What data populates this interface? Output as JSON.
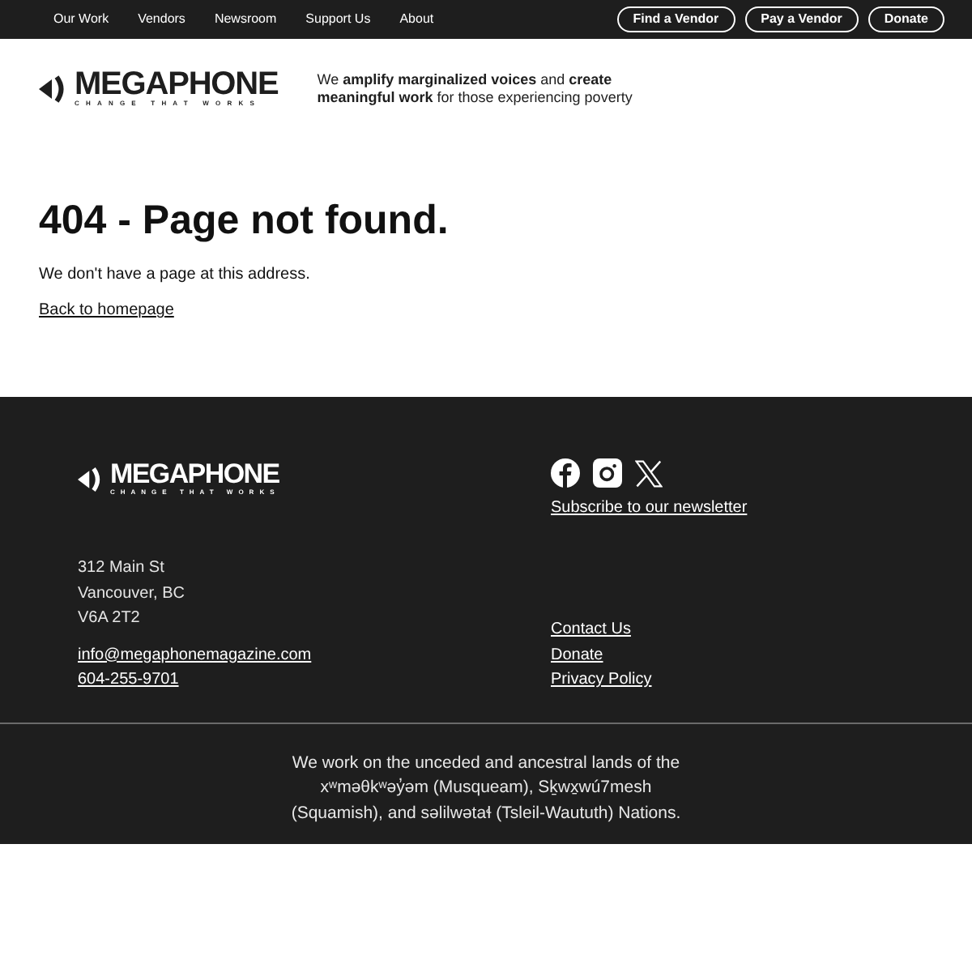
{
  "top_nav": {
    "links": [
      "Our Work",
      "Vendors",
      "Newsroom",
      "Support Us",
      "About"
    ],
    "buttons": [
      "Find a Vendor",
      "Pay a Vendor",
      "Donate"
    ]
  },
  "header": {
    "logo": {
      "wordmark": "MEGAPHONE",
      "tagline": "CHANGE THAT WORKS"
    },
    "mission": "We **amplify marginalized voices** and **create meaningful work** for those experiencing poverty"
  },
  "main": {
    "heading": "404 - Page not found.",
    "message": "We don't have a page at this address.",
    "link": "Back to homepage"
  },
  "footer": {
    "logo": {
      "wordmark": "MEGAPHONE",
      "tagline": "CHANGE THAT WORKS"
    },
    "social_icons": [
      {
        "kind": "facebook"
      },
      {
        "kind": "instagram"
      },
      {
        "kind": "x"
      }
    ],
    "newsletter_link": "Subscribe to our newsletter",
    "address": [
      "312 Main St",
      "Vancouver, BC",
      "V6A 2T2"
    ],
    "contact_links": [
      "info@megaphonemagazine.com",
      "604-255-9701"
    ],
    "links": [
      "Contact Us",
      "Donate",
      "Privacy Policy"
    ],
    "land_acknowledgement": "We work on the unceded and ancestral lands of the xʷməθkʷəy̓əm (Musqueam), Sḵwx̱wú7mesh (Squamish), and səlilwətaɬ (Tsleil-Waututh) Nations."
  }
}
